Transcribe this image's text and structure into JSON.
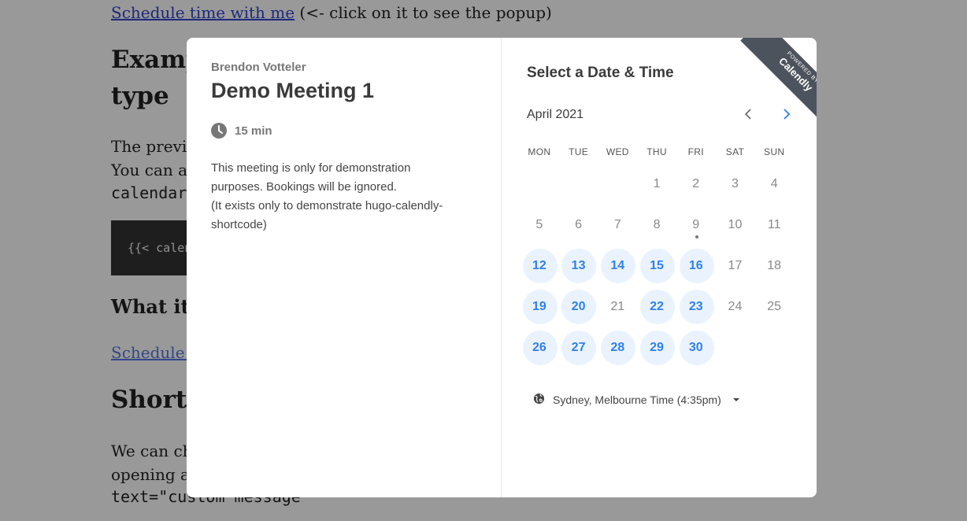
{
  "background_page": {
    "link_text": "Schedule time with me",
    "link_suffix": " (<- click on it to see the popup)",
    "heading1_line1": "Examp",
    "heading1_line2": "type",
    "para1_line1": "The previo",
    "para1_line2": "You can als",
    "code_inline": "calendar",
    "code_block": "{{< calen",
    "heading2": "What it l",
    "link2_text": "Schedule ti",
    "heading3": "Shortc",
    "para2_line1": "We can cha",
    "para2_line2": "opening an",
    "code_inline2": "text=\"custom message\""
  },
  "popup": {
    "organizer": "Brendon Votteler",
    "event_title": "Demo Meeting 1",
    "duration": "15 min",
    "description": [
      "This meeting is only for demonstration purposes. Bookings will be ignored.",
      "(It exists only to demonstrate hugo-calendly-shortcode)"
    ],
    "select_heading": "Select a Date & Time",
    "month": "April 2021",
    "weekdays": [
      "MON",
      "TUE",
      "WED",
      "THU",
      "FRI",
      "SAT",
      "SUN"
    ],
    "weeks": [
      [
        {
          "d": ""
        },
        {
          "d": ""
        },
        {
          "d": ""
        },
        {
          "d": "1"
        },
        {
          "d": "2"
        },
        {
          "d": "3"
        },
        {
          "d": "4"
        }
      ],
      [
        {
          "d": "5"
        },
        {
          "d": "6"
        },
        {
          "d": "7"
        },
        {
          "d": "8"
        },
        {
          "d": "9",
          "today": true
        },
        {
          "d": "10"
        },
        {
          "d": "11"
        }
      ],
      [
        {
          "d": "12",
          "avail": true
        },
        {
          "d": "13",
          "avail": true
        },
        {
          "d": "14",
          "avail": true
        },
        {
          "d": "15",
          "avail": true
        },
        {
          "d": "16",
          "avail": true
        },
        {
          "d": "17"
        },
        {
          "d": "18"
        }
      ],
      [
        {
          "d": "19",
          "avail": true
        },
        {
          "d": "20",
          "avail": true
        },
        {
          "d": "21"
        },
        {
          "d": "22",
          "avail": true
        },
        {
          "d": "23",
          "avail": true
        },
        {
          "d": "24"
        },
        {
          "d": "25"
        }
      ],
      [
        {
          "d": "26",
          "avail": true
        },
        {
          "d": "27",
          "avail": true
        },
        {
          "d": "28",
          "avail": true
        },
        {
          "d": "29",
          "avail": true
        },
        {
          "d": "30",
          "avail": true
        },
        {
          "d": ""
        },
        {
          "d": ""
        }
      ]
    ],
    "timezone": "Sydney, Melbourne Time (4:35pm)",
    "ribbon_small": "POWERED BY",
    "ribbon_brand": "Calendly"
  },
  "colors": {
    "accent": "#2f80ed",
    "available_bg": "#eaf3fd",
    "ribbon": "#4d535c"
  },
  "icons": {
    "duration": "clock-icon",
    "timezone": "globe-icon",
    "prev": "chevron-left-icon",
    "next": "chevron-right-icon"
  }
}
